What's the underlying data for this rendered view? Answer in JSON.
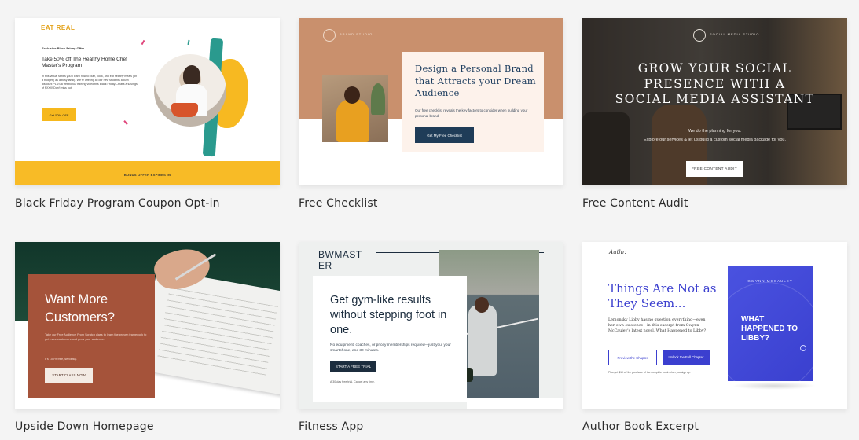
{
  "templates": [
    {
      "label": "Black Friday Program Coupon Opt-in",
      "preview": {
        "logo": "EAT REAL",
        "eyebrow": "Exclusive Black Friday Offer",
        "headline": "Take 50% off The Healthy Home Chef Master's Program",
        "body": "In this virtual series you'll learn how to plan, cook, and eat healthy meals (on a budget!) as a busy family. We're offering all our new students a 50% discount PLUS a freebonus training video this Black Friday—that's a savings of $XXX! Don't miss out!",
        "cta": "Get 50% OFF",
        "footer": "BONUS OFFER EXPIRES IN"
      }
    },
    {
      "label": "Free Checklist",
      "preview": {
        "logo": "BRAND STUDIO",
        "headline": "Design a Personal Brand that Attracts your Dream Audience",
        "body": "Our free checklist reveals the key factors to consider when building your personal brand.",
        "cta": "Get My Free Checklist"
      }
    },
    {
      "label": "Free Content Audit",
      "preview": {
        "logo": "SOCIAL MEDIA STUDIO",
        "headline": "GROW YOUR SOCIAL PRESENCE WITH A SOCIAL MEDIA ASSISTANT",
        "sub1": "We do the planning for you.",
        "sub2": "Explore our services & let us build a custom social media package for you.",
        "cta": "FREE CONTENT AUDIT"
      }
    },
    {
      "label": "Upside Down Homepage",
      "preview": {
        "headline": "Want More Customers?",
        "body": "Take our Free Audience From Scratch class to learn the proven framework to get more customers and grow your audience.",
        "small": "It's 100% free, seriously.",
        "cta": "START CLASS NOW"
      }
    },
    {
      "label": "Fitness App",
      "preview": {
        "logo": "BWMAST ER",
        "headline": "Get gym-like results without stepping foot in one.",
        "body": "No equipment, coaches, or pricey memberships required—just you, your smartphone, and 30 minutes.",
        "cta": "START A FREE TRIAL",
        "tiny": "A 30-day free trial. Cancel any time."
      }
    },
    {
      "label": "Author Book Excerpt",
      "preview": {
        "logo": "Authr.",
        "headline": "Things Are Not as They Seem...",
        "body": "Lemonsky Libby has no question everything—even her own existence—in this excerpt from Gwynn McCauley's latest novel, What Happened to Libby?",
        "cta_primary": "Preview the Chapter",
        "cta_secondary": "Unlock the Full Chapter",
        "tiny": "Plus get $10 off the purchase of the complete book when you sign up.",
        "book_author": "GWYNN MCCAULEY",
        "book_title": "WHAT HAPPENED TO LIBBY?"
      }
    }
  ],
  "colors": {
    "page_bg": "#f4f4f4",
    "eat_real_yellow": "#f8bb26",
    "checklist_tan": "#c9906d",
    "checklist_navy": "#1f3c58",
    "homepage_rust": "#a5533a",
    "fitness_navy": "#1c2d3e",
    "author_blue": "#3b3fcf"
  }
}
